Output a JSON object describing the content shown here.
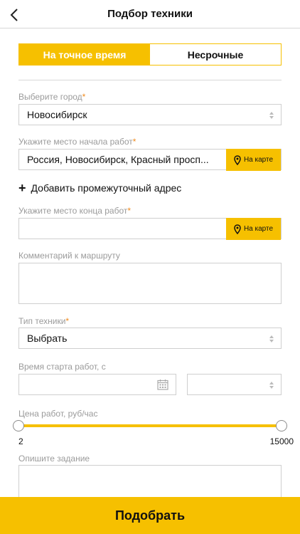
{
  "header": {
    "title": "Подбор техники",
    "back_icon": "chevron-left-icon"
  },
  "tabs": [
    {
      "label": "На точное время",
      "active": true
    },
    {
      "label": "Несрочные",
      "active": false
    }
  ],
  "colors": {
    "accent": "#f6c000",
    "required": "#f08a1c",
    "label": "#9b9b9b",
    "border": "#cfcfcf"
  },
  "form": {
    "city": {
      "label": "Выберите город",
      "required_mark": "*",
      "value": "Новосибирск"
    },
    "start": {
      "label": "Укажите место начала работ",
      "required_mark": "*",
      "value": "Россия, Новосибирск, Красный просп...",
      "map_button": "На карте"
    },
    "add_intermediate": {
      "plus": "+",
      "label": "Добавить промежуточный адрес"
    },
    "end": {
      "label": "Укажите место конца работ",
      "required_mark": "*",
      "value": "",
      "map_button": "На карте"
    },
    "comment": {
      "label": "Комментарий к маршруту",
      "value": ""
    },
    "equipment": {
      "label": "Тип техники",
      "required_mark": "*",
      "value": "Выбрать"
    },
    "start_time": {
      "label": "Время старта работ, с",
      "date_value": "",
      "time_value": ""
    },
    "price": {
      "label": "Цена работ, руб/час",
      "min": "2",
      "max": "15000",
      "range_fraction": [
        0,
        1
      ]
    },
    "task": {
      "label": "Опишите задание",
      "value": ""
    }
  },
  "submit": {
    "label": "Подобрать"
  }
}
